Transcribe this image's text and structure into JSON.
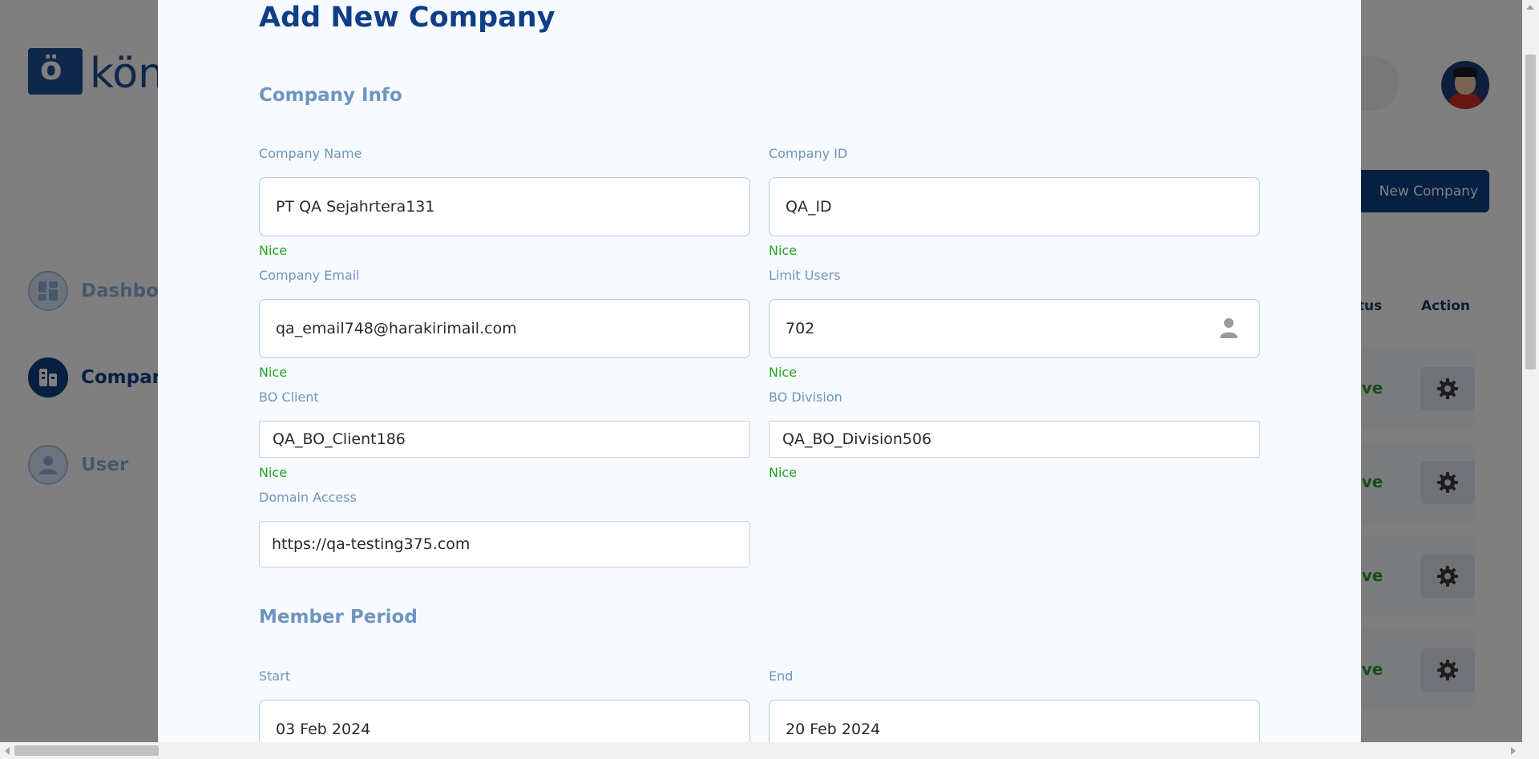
{
  "app": {
    "logo_text": "kön",
    "sidebar": [
      {
        "label": "Dashboard"
      },
      {
        "label": "Company"
      },
      {
        "label": "User"
      }
    ],
    "new_company_button": "New Company",
    "table_headers": {
      "status": "Status",
      "action": "Action"
    },
    "rows": [
      {
        "status": "Active"
      },
      {
        "status": "Active"
      },
      {
        "status": "Active"
      },
      {
        "status": "Active"
      }
    ]
  },
  "modal": {
    "title": "Add New Company",
    "sections": {
      "company_info": "Company Info",
      "member_period": "Member Period"
    },
    "fields": {
      "company_name": {
        "label": "Company Name",
        "value": "PT QA Sejahrtera131",
        "hint": "Nice"
      },
      "company_id": {
        "label": "Company ID",
        "value": "QA_ID",
        "hint": "Nice"
      },
      "company_email": {
        "label": "Company Email",
        "value": "qa_email748@harakirimail.com",
        "hint": "Nice"
      },
      "limit_users": {
        "label": "Limit Users",
        "value": "702",
        "hint": "Nice"
      },
      "bo_client": {
        "label": "BO Client",
        "value": "QA_BO_Client186",
        "hint": "Nice"
      },
      "bo_division": {
        "label": "BO Division",
        "value": "QA_BO_Division506",
        "hint": "Nice"
      },
      "domain_access": {
        "label": "Domain Access",
        "value": "https://qa-testing375.com"
      },
      "start": {
        "label": "Start",
        "value": "03 Feb 2024"
      },
      "end": {
        "label": "End",
        "value": "20 Feb 2024"
      }
    }
  },
  "colors": {
    "primary": "#0f3e87",
    "label": "#6f94bf",
    "success": "#23a423",
    "modal_bg": "#f7faff"
  }
}
